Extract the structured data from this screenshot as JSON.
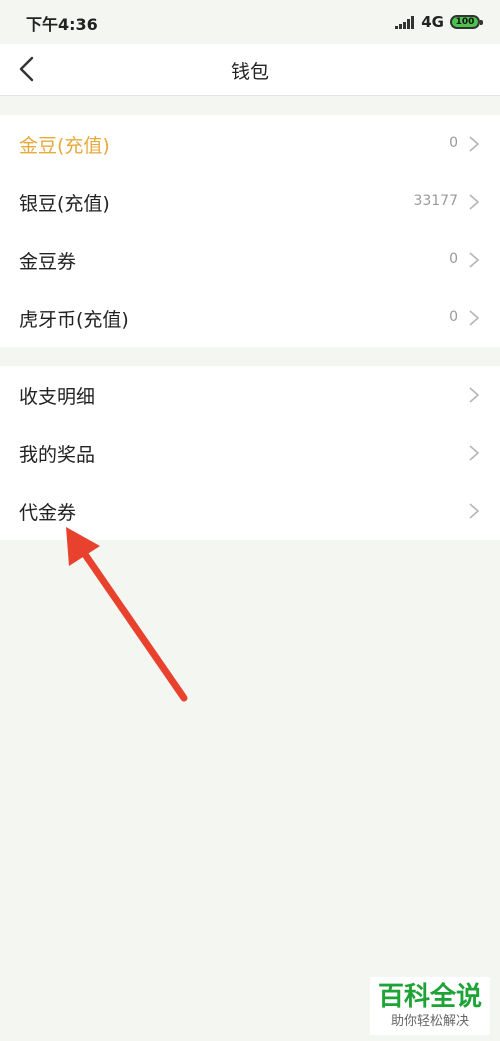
{
  "status_bar": {
    "time": "下午4:36",
    "network": "4G",
    "battery": "100"
  },
  "nav": {
    "title": "钱包"
  },
  "sections": [
    {
      "rows": [
        {
          "label": "金豆(充值)",
          "value": "0",
          "highlight": true
        },
        {
          "label": "银豆(充值)",
          "value": "33177",
          "highlight": false
        },
        {
          "label": "金豆券",
          "value": "0",
          "highlight": false
        },
        {
          "label": "虎牙币(充值)",
          "value": "0",
          "highlight": false
        }
      ]
    },
    {
      "rows": [
        {
          "label": "收支明细"
        },
        {
          "label": "我的奖品"
        },
        {
          "label": "代金券"
        }
      ]
    }
  ],
  "colors": {
    "highlight": "#e7a93c",
    "background": "#f4f6f1",
    "arrow": "#e8422f",
    "watermark": "#1ea337"
  },
  "watermark": {
    "main": "百科全说",
    "sub": "助你轻松解决"
  }
}
